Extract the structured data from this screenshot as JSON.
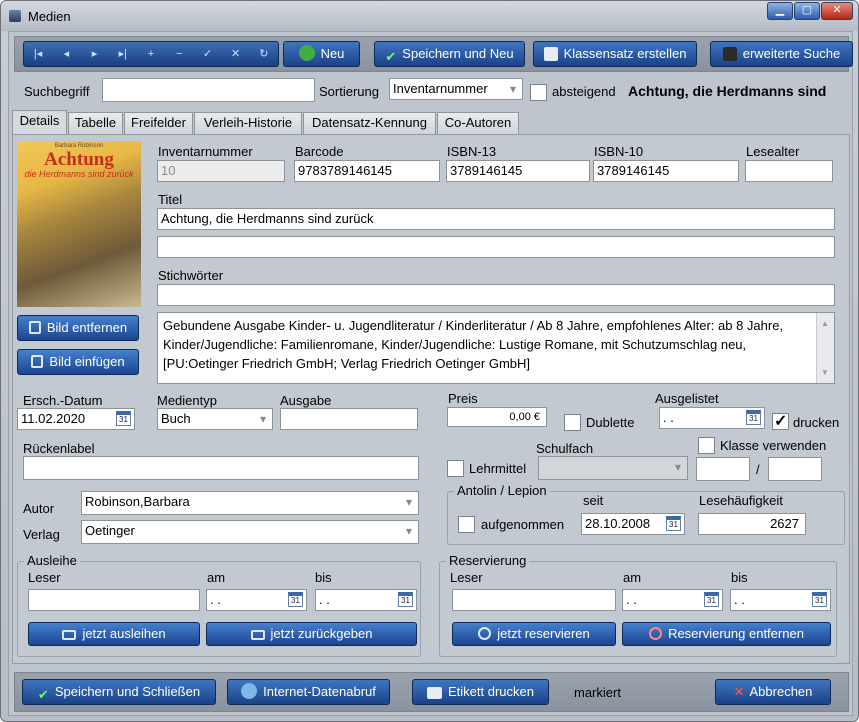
{
  "window": {
    "title": "Medien",
    "min": "▁",
    "max": "▢",
    "close": "✕"
  },
  "toolbar": {
    "nav": [
      "|◂",
      "◂",
      "▸",
      "▸|",
      "+",
      "−",
      "✓",
      "✕",
      "↻"
    ],
    "new_label": "Neu",
    "save_new_label": "Speichern und Neu",
    "class_set_label": "Klassensatz erstellen",
    "adv_search_label": "erweiterte Suche"
  },
  "search": {
    "label": "Suchbegriff",
    "value": "",
    "sort_label": "Sortierung",
    "sort_value": "Inventarnummer",
    "desc_label": "absteigend",
    "current_record": "Achtung, die Herdmanns sind"
  },
  "tabs": [
    "Details",
    "Tabelle",
    "Freifelder",
    "Verleih-Historie",
    "Datensatz-Kennung",
    "Co-Autoren"
  ],
  "cover": {
    "author": "Barbara Robinson",
    "title": "Achtung",
    "subtitle": "die Herdmanns sind zurück"
  },
  "buttons": {
    "remove_image": "Bild entfernen",
    "insert_image": "Bild einfügen"
  },
  "fields": {
    "inventory_label": "Inventarnummer",
    "inventory": "10",
    "barcode_label": "Barcode",
    "barcode": "9783789146145",
    "isbn13_label": "ISBN-13",
    "isbn13": "3789146145",
    "isbn10_label": "ISBN-10",
    "isbn10": "3789146145",
    "age_label": "Lesealter",
    "age": "",
    "title_label": "Titel",
    "title": "Achtung, die Herdmanns sind zurück",
    "title2": "",
    "keywords_label": "Stichwörter",
    "keywords": "",
    "description": "Gebundene Ausgabe  Kinder- u. Jugendliteratur / Kinderliteratur / Ab 8 Jahre, empfohlenes Alter: ab 8 Jahre, Kinder/Jugendliche: Familienromane, Kinder/Jugendliche: Lustige Romane, mit Schutzumschlag neu, [PU:Oetinger Friedrich GmbH; Verlag Friedrich Oetinger GmbH]",
    "pubdate_label": "Ersch.-Datum",
    "pubdate": "11.02.2020",
    "mediatype_label": "Medientyp",
    "mediatype": "Buch",
    "edition_label": "Ausgabe",
    "edition": "",
    "price_label": "Preis",
    "price": "0,00 €",
    "duplicate_label": "Dublette",
    "delisted_label": "Ausgelistet",
    "delisted": " .  .",
    "print_label": "drucken",
    "spine_label": "Rückenlabel",
    "spine": "",
    "subject_label": "Schulfach",
    "subject": "",
    "teaching_label": "Lehrmittel",
    "use_class_label": "Klasse verwenden",
    "class_from": "",
    "class_sep": "/",
    "class_to": "",
    "author_label": "Autor",
    "author": "Robinson,Barbara",
    "publisher_label": "Verlag",
    "publisher": "Oetinger"
  },
  "antolin": {
    "group_label": "Antolin / Lepion",
    "since_label": "seit",
    "added_label": "aufgenommen",
    "since": "28.10.2008",
    "freq_label": "Lesehäufigkeit",
    "freq": "2627"
  },
  "loan": {
    "group_label": "Ausleihe",
    "reader_label": "Leser",
    "reader": "",
    "on_label": "am",
    "on": " .  .",
    "until_label": "bis",
    "until": " .  .",
    "lend_button": "jetzt ausleihen",
    "return_button": "jetzt zurückgeben"
  },
  "reservation": {
    "group_label": "Reservierung",
    "reader_label": "Leser",
    "reader": "",
    "on_label": "am",
    "on": " .  .",
    "until_label": "bis",
    "until": " .  .",
    "reserve_button": "jetzt reservieren",
    "remove_button": "Reservierung entfernen"
  },
  "footer": {
    "save_close": "Speichern und Schließen",
    "internet": "Internet-Datenabruf",
    "print_label": "Etikett drucken",
    "marked": "markiert",
    "cancel": "Abbrechen"
  },
  "cal_glyph": "31",
  "print_checked": true,
  "colors": {
    "accent": "#1c4590",
    "window": "#bfc5cd",
    "cover_title": "#c92c1b"
  }
}
